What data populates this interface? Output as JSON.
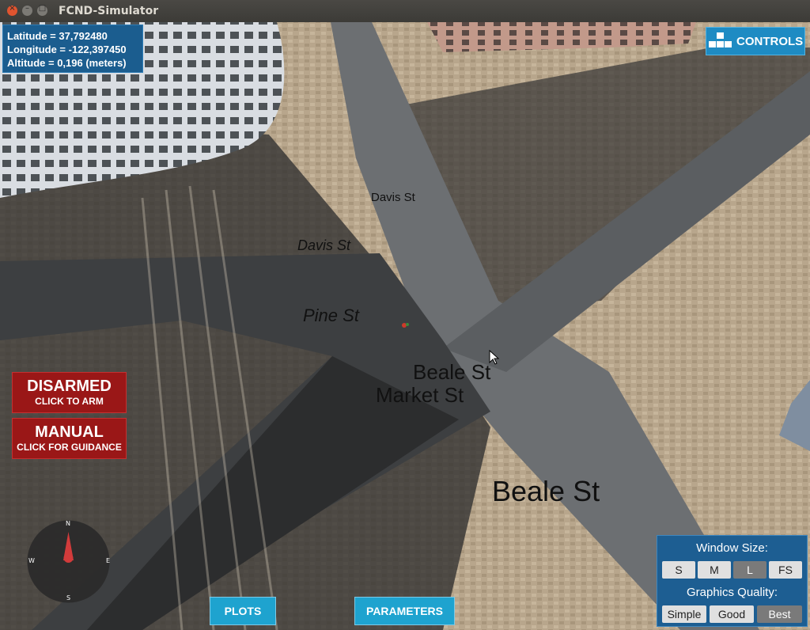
{
  "window": {
    "title": "FCND-Simulator"
  },
  "telemetry": {
    "latitude": "Latitude = 37,792480",
    "longitude": "Longitude = -122,397450",
    "altitude": "Altitude = 0,196 (meters)"
  },
  "controls": {
    "label": "CONTROLS"
  },
  "streets": [
    "Davis St",
    "Davis St",
    "Pine St",
    "Beale St",
    "Market St",
    "Beale St"
  ],
  "arm": {
    "title": "DISARMED",
    "subtitle": "CLICK TO ARM"
  },
  "mode": {
    "title": "MANUAL",
    "subtitle": "CLICK FOR GUIDANCE"
  },
  "compass": {
    "n": "N",
    "s": "S",
    "e": "E",
    "w": "W"
  },
  "bottom": {
    "plots": "PLOTS",
    "parameters": "PARAMETERS"
  },
  "settings": {
    "window_size_label": "Window Size:",
    "sizes": [
      "S",
      "M",
      "L",
      "FS"
    ],
    "selected_size": "L",
    "quality_label": "Graphics Quality:",
    "qualities": [
      "Simple",
      "Good",
      "Best"
    ],
    "selected_quality": "Best"
  },
  "colors": {
    "accent": "#1ea3cf",
    "panel": "#1d5e92",
    "danger": "#9a1717"
  }
}
